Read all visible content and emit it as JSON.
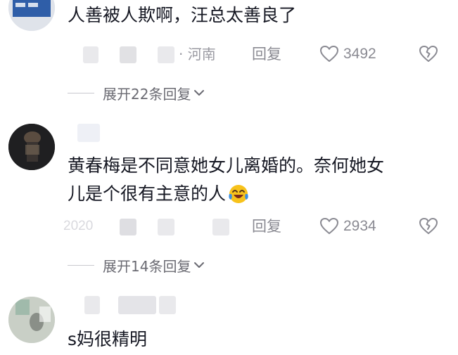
{
  "comments": [
    {
      "text_lines": [
        "人善被人欺啊，汪总太善良了"
      ],
      "location": "· 河南",
      "reply_label": "回复",
      "likes": "3492",
      "expand_label": "展开22条回复"
    },
    {
      "text_lines": [
        "黄春梅是不同意她女儿离婚的。奈何她女",
        "儿是个很有主意的人"
      ],
      "emoji": "laughing-tears-emoji",
      "date_fragment": "2020",
      "reply_label": "回复",
      "likes": "2934",
      "expand_label": "展开14条回复"
    },
    {
      "text_lines": [
        "s妈很精明"
      ]
    }
  ],
  "icons": [
    "heart-icon",
    "broken-heart-icon",
    "chevron-down-icon"
  ],
  "colors": {
    "text": "#161823",
    "secondary": "#8a8a92",
    "blurred": "#e9e9ec",
    "emoji_yellow": "#f7c21b",
    "emoji_tear": "#3c8fe0"
  }
}
